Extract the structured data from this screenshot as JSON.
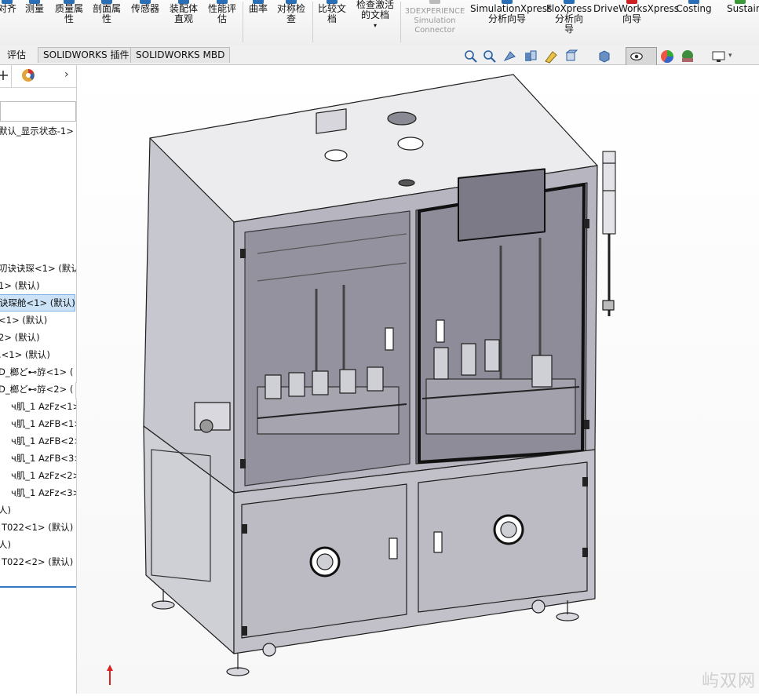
{
  "ribbon": {
    "buttons": [
      {
        "label": "对齐",
        "name": "align-button"
      },
      {
        "label": "测量",
        "name": "measure-button"
      },
      {
        "label": "质量属\n性",
        "name": "mass-properties-button"
      },
      {
        "label": "剖面属\n性",
        "name": "section-properties-button"
      },
      {
        "label": "传感器",
        "name": "sensor-button"
      },
      {
        "label": "装配体\n直观",
        "name": "assembly-visualization-button"
      },
      {
        "label": "性能评\n估",
        "name": "performance-evaluation-button"
      },
      {
        "label": "曲率",
        "name": "curvature-button"
      },
      {
        "label": "对称检\n查",
        "name": "symmetry-check-button"
      },
      {
        "label": "比较文\n档",
        "name": "compare-documents-button"
      },
      {
        "label": "检查激活\n的文档",
        "name": "check-active-document-button"
      },
      {
        "label": "3DEXPERIENCE\nSimulation\nConnector",
        "name": "simulation-connector-button"
      },
      {
        "label": "SimulationXpress\n分析向导",
        "name": "simulationxpress-button"
      },
      {
        "label": "FloXpress\n分析向\n导",
        "name": "floxpress-button"
      },
      {
        "label": "DriveWorksXpress\n向导",
        "name": "driveworksxpress-button"
      },
      {
        "label": "Costing",
        "name": "costing-button"
      },
      {
        "label": "Sustain",
        "name": "sustainability-button"
      }
    ]
  },
  "tabs": [
    "评估",
    "SOLIDWORKS 插件",
    "SOLIDWORKS MBD"
  ],
  "tree": {
    "items": [
      "默认_显示状态-1>",
      "叨诀诀琛<1> (默认",
      "1> (默认)",
      "诀琛舱<1> (默认)",
      "<1> (默认)",
      "2> (默认)",
      ".<1> (默认)",
      "D_榔ど⊷斿<1> (",
      "D_榔ど⊷斿<2> (",
      "ч肌_1 AzFz<1>",
      "ч肌_1 AzFB<1>",
      "ч肌_1 AzFB<2>",
      "ч肌_1 AzFB<3>",
      "ч肌_1 AzFz<2>",
      "ч肌_1 AzFz<3>",
      "人)",
      "T022<1> (默认)",
      "人)",
      "T022<2> (默认)"
    ]
  },
  "watermark": "屿双网",
  "colors": {
    "accent": "#2a6fb5",
    "selection": "#cce3f7",
    "machine": "#cfcfd6"
  }
}
